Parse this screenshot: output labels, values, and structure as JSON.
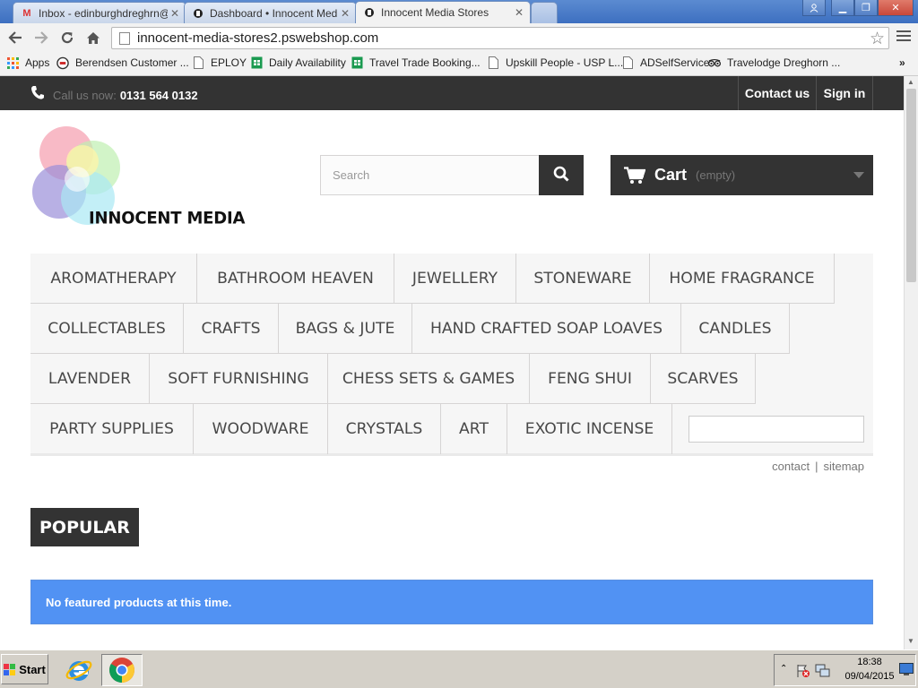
{
  "browser": {
    "tabs": [
      {
        "title": "Inbox - edinburghdreghrn@",
        "icon": "gmail-icon"
      },
      {
        "title": "Dashboard • Innocent Media",
        "icon": "prestashop-icon"
      },
      {
        "title": "Innocent Media Stores",
        "icon": "prestashop-icon",
        "active": true
      }
    ],
    "url": "innocent-media-stores2.pswebshop.com",
    "bookmarks": [
      {
        "label": "Apps",
        "icon": "apps-grid-icon"
      },
      {
        "label": "Berendsen Customer ...",
        "icon": "berendsen-icon"
      },
      {
        "label": "EPLOY",
        "icon": "page-icon"
      },
      {
        "label": "Daily Availability",
        "icon": "sheets-icon"
      },
      {
        "label": "Travel Trade Booking...",
        "icon": "sheets-icon"
      },
      {
        "label": "Upskill People - USP L...",
        "icon": "page-icon"
      },
      {
        "label": "ADSelfService",
        "icon": "page-icon"
      },
      {
        "label": "Travelodge Dreghorn ...",
        "icon": "tripadvisor-icon"
      }
    ],
    "bookmarks_overflow": "»"
  },
  "store": {
    "call_label": "Call us now:",
    "phone": "0131 564 0132",
    "contact_us": "Contact us",
    "sign_in": "Sign in",
    "logo_text": "INNOCENT MEDIA",
    "search_placeholder": "Search",
    "cart_label": "Cart",
    "cart_state": "(empty)",
    "menu": [
      [
        "AROMATHERAPY",
        "BATHROOM HEAVEN",
        "JEWELLERY",
        "STONEWARE",
        "HOME FRAGRANCE"
      ],
      [
        "COLLECTABLES",
        "CRAFTS",
        "BAGS & JUTE",
        "HAND CRAFTED SOAP LOAVES",
        "CANDLES"
      ],
      [
        "LAVENDER",
        "SOFT FURNISHING",
        "CHESS SETS & GAMES",
        "FENG SHUI",
        "SCARVES"
      ],
      [
        "PARTY SUPPLIES",
        "WOODWARE",
        "CRYSTALS",
        "ART",
        "EXOTIC INCENSE"
      ]
    ],
    "contact_link": "contact",
    "sitemap_link": "sitemap",
    "popular_heading": "POPULAR",
    "no_products": "No featured products at this time."
  },
  "taskbar": {
    "start": "Start",
    "time": "18:38",
    "date": "09/04/2015"
  },
  "colors": {
    "dark": "#333333",
    "notice_blue": "#5192f3"
  }
}
